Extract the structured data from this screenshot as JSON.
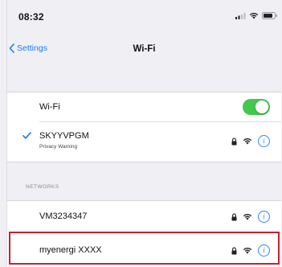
{
  "status_bar": {
    "time": "08:32",
    "icons": [
      "cellular-signal-icon",
      "wifi-icon",
      "battery-icon"
    ]
  },
  "nav": {
    "back_label": "Settings",
    "title": "Wi-Fi"
  },
  "wifi": {
    "label": "Wi-Fi",
    "enabled": true
  },
  "connected_network": {
    "name": "SKYYVPGM",
    "subtitle": "Privacy Warning",
    "secured": true
  },
  "networks_section": {
    "header": "NETWORKS",
    "items": [
      {
        "name": "VM3234347",
        "secured": true
      },
      {
        "name": "myenergi XXXX",
        "secured": true,
        "highlighted": true
      }
    ]
  },
  "colors": {
    "accent_blue": "#1a7cf5",
    "toggle_green": "#43c74f",
    "highlight_red": "#cc1f2e",
    "background": "#efeff4"
  }
}
